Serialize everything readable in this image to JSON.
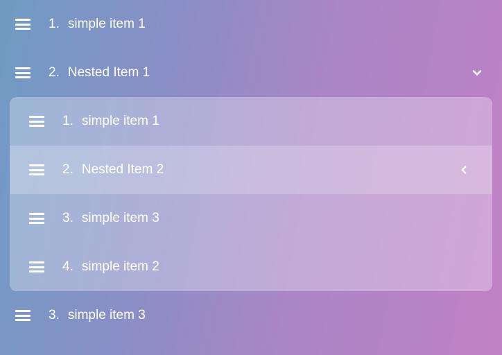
{
  "list": [
    {
      "num": "1.",
      "label": "simple item 1",
      "expand": null
    },
    {
      "num": "2.",
      "label": "Nested Item 1",
      "expand": "down"
    },
    {
      "num": "3.",
      "label": "simple item 3",
      "expand": null
    }
  ],
  "nested": [
    {
      "num": "1.",
      "label": "simple item 1",
      "expand": null,
      "highlight": false
    },
    {
      "num": "2.",
      "label": "Nested Item 2",
      "expand": "left",
      "highlight": true
    },
    {
      "num": "3.",
      "label": "simple item 3",
      "expand": null,
      "highlight": false
    },
    {
      "num": "4.",
      "label": "simple item 2",
      "expand": null,
      "highlight": false
    }
  ]
}
